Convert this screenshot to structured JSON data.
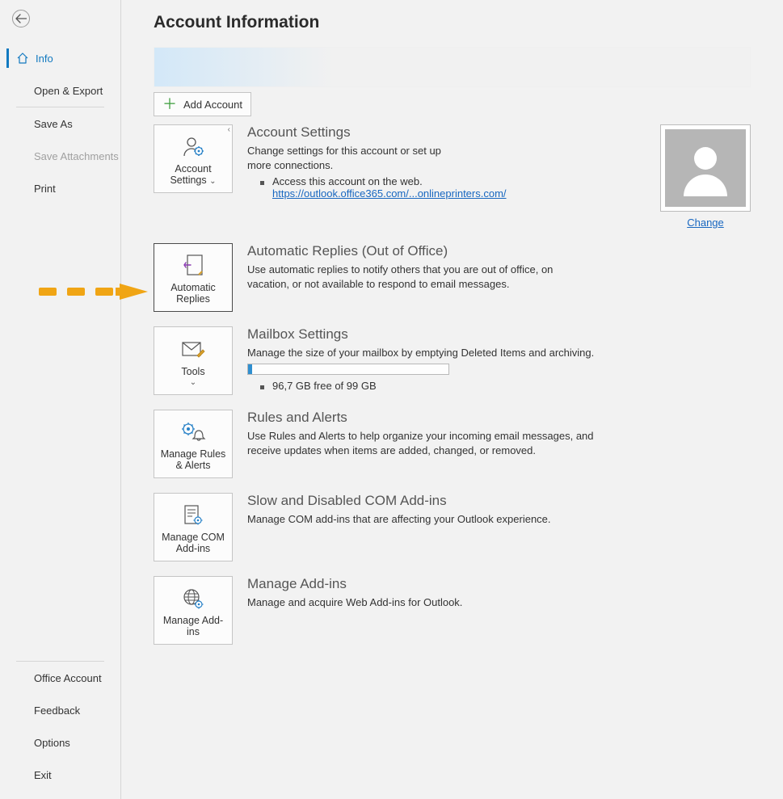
{
  "sidebar": {
    "nav_top": [
      {
        "label": "Info",
        "active": true,
        "has_home_icon": true
      },
      {
        "label": "Open & Export",
        "indented": true
      }
    ],
    "nav_mid": [
      {
        "label": "Save As"
      },
      {
        "label": "Save Attachments",
        "disabled": true
      },
      {
        "label": "Print"
      }
    ],
    "nav_bottom": [
      {
        "label": "Office Account"
      },
      {
        "label": "Feedback"
      },
      {
        "label": "Options"
      },
      {
        "label": "Exit"
      }
    ]
  },
  "page": {
    "title": "Account Information",
    "add_account_label": "Add Account"
  },
  "account_settings": {
    "tile_label_1": "Account",
    "tile_label_2": "Settings",
    "heading": "Account Settings",
    "desc": "Change settings for this account or set up more connections.",
    "bullet_text": "Access this account on the web.",
    "link_text": "https://outlook.office365.com/...onlineprinters.com/",
    "change_label": "Change"
  },
  "auto_replies": {
    "tile_label_1": "Automatic",
    "tile_label_2": "Replies",
    "heading": "Automatic Replies (Out of Office)",
    "desc": "Use automatic replies to notify others that you are out of office, on vacation, or not available to respond to email messages."
  },
  "mailbox": {
    "tile_label": "Tools",
    "heading": "Mailbox Settings",
    "desc": "Manage the size of your mailbox by emptying Deleted Items and archiving.",
    "free_text": "96,7 GB free of 99 GB"
  },
  "rules": {
    "tile_label_1": "Manage Rules",
    "tile_label_2": "& Alerts",
    "heading": "Rules and Alerts",
    "desc": "Use Rules and Alerts to help organize your incoming email messages, and receive updates when items are added, changed, or removed."
  },
  "com_addins": {
    "tile_label_1": "Manage COM",
    "tile_label_2": "Add-ins",
    "heading": "Slow and Disabled COM Add-ins",
    "desc": "Manage COM add-ins that are affecting your Outlook experience."
  },
  "manage_addins": {
    "tile_label_1": "Manage Add-",
    "tile_label_2": "ins",
    "heading": "Manage Add-ins",
    "desc": "Manage and acquire Web Add-ins for Outlook."
  }
}
